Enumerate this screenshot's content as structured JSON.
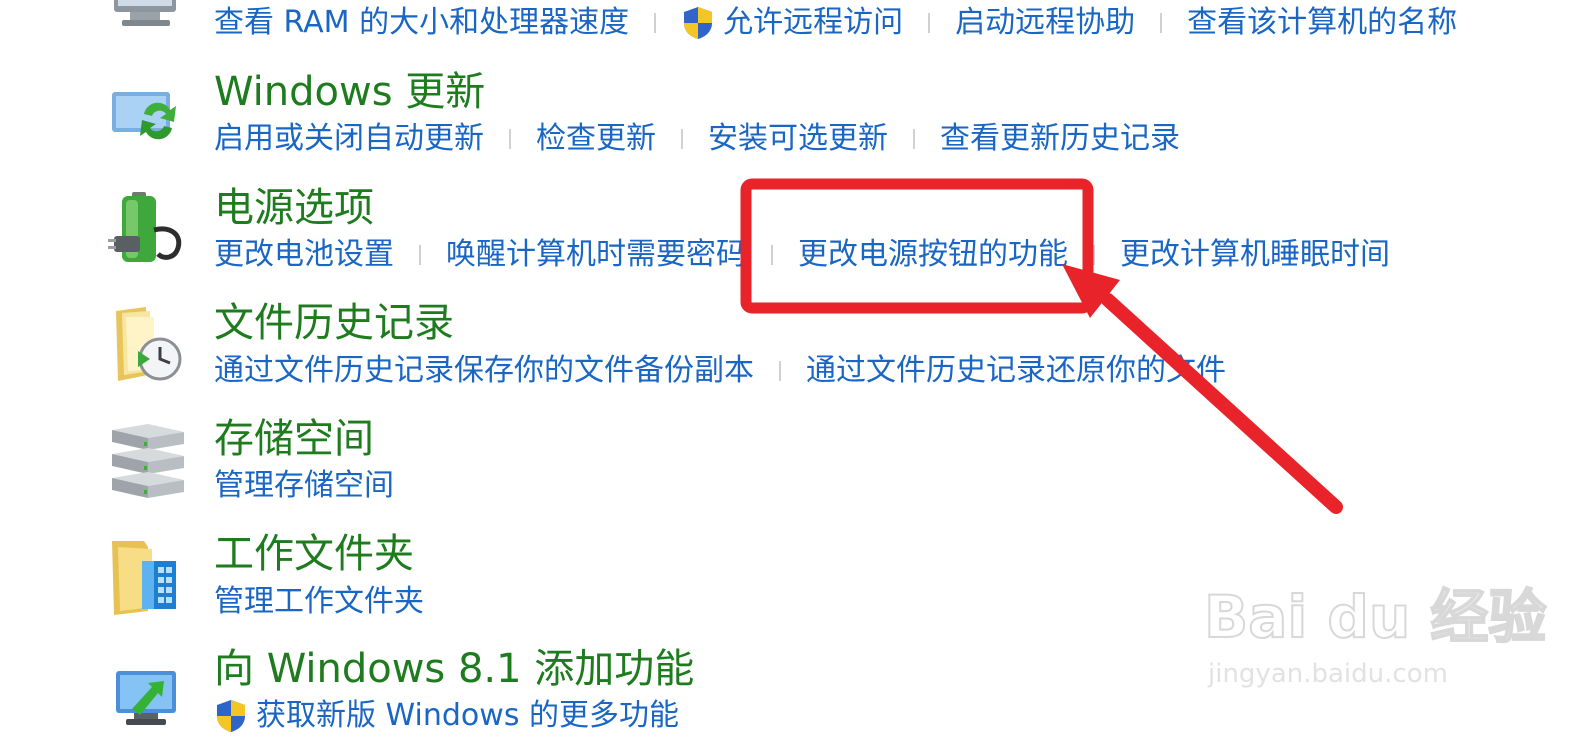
{
  "sections": [
    {
      "title": "",
      "links": [
        {
          "label": "查看 RAM 的大小和处理器速度",
          "shield": false
        },
        {
          "label": "允许远程访问",
          "shield": true
        },
        {
          "label": "启动远程协助",
          "shield": false
        },
        {
          "label": "查看该计算机的名称",
          "shield": false
        }
      ]
    },
    {
      "title": "Windows 更新",
      "links": [
        {
          "label": "启用或关闭自动更新"
        },
        {
          "label": "检查更新"
        },
        {
          "label": "安装可选更新"
        },
        {
          "label": "查看更新历史记录"
        }
      ]
    },
    {
      "title": "电源选项",
      "links": [
        {
          "label": "更改电池设置"
        },
        {
          "label": "唤醒计算机时需要密码"
        },
        {
          "label": "更改电源按钮的功能"
        },
        {
          "label": "更改计算机睡眠时间"
        }
      ]
    },
    {
      "title": "文件历史记录",
      "links": [
        {
          "label": "通过文件历史记录保存你的文件备份副本"
        },
        {
          "label": "通过文件历史记录还原你的文件"
        }
      ]
    },
    {
      "title": "存储空间",
      "links": [
        {
          "label": "管理存储空间"
        }
      ]
    },
    {
      "title": "工作文件夹",
      "links": [
        {
          "label": "管理工作文件夹"
        }
      ]
    },
    {
      "title": "向 Windows 8.1 添加功能",
      "links": [
        {
          "label": "获取新版 Windows 的更多功能",
          "shield": true
        }
      ]
    }
  ],
  "colors": {
    "title": "#1e7b1e",
    "link": "#1a66c4",
    "annotation": "#e8232a"
  },
  "icons": [
    "system-icon",
    "windows-update-icon",
    "power-options-icon",
    "file-history-icon",
    "storage-spaces-icon",
    "work-folders-icon",
    "add-features-icon",
    "uac-shield-icon"
  ],
  "watermark": {
    "brand": "Bai du 经验",
    "url": "jingyan.baidu.com"
  }
}
